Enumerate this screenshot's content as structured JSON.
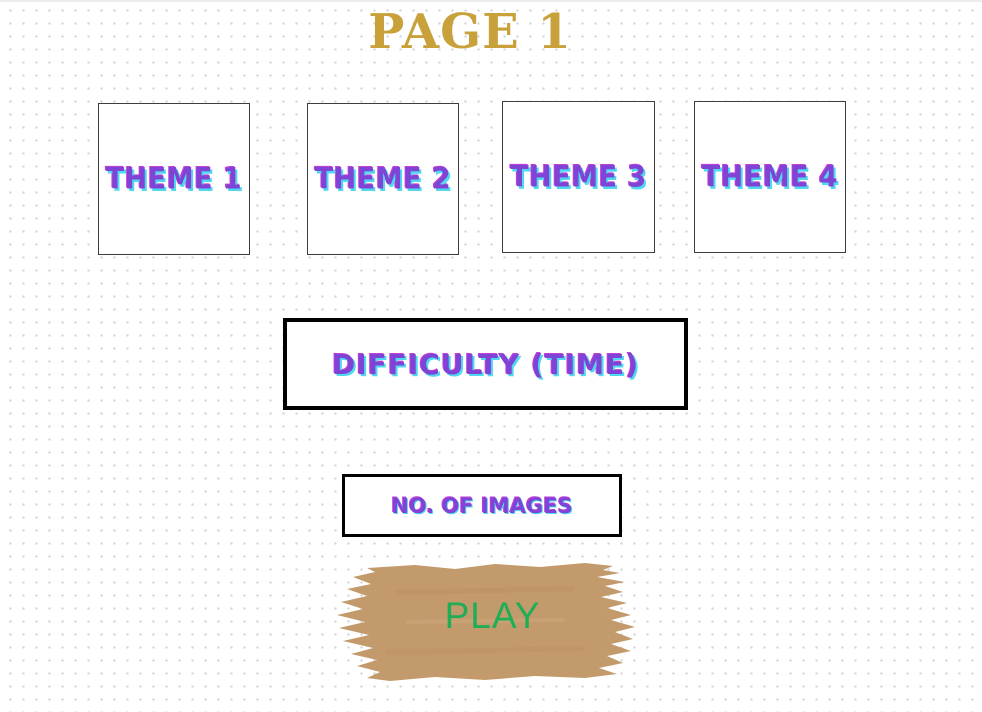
{
  "page": {
    "title": "PAGE 1"
  },
  "themes": [
    {
      "label": "THEME 1"
    },
    {
      "label": "THEME 2"
    },
    {
      "label": "THEME 3"
    },
    {
      "label": "THEME 4"
    }
  ],
  "difficulty": {
    "label": "DIFFICULTY (TIME)"
  },
  "images": {
    "label": "NO. OF IMAGES"
  },
  "play": {
    "label": "PLAY"
  },
  "colors": {
    "title": "#c9a13a",
    "theme_text": "#7f43d6",
    "theme_shadow": "#4fd9f0",
    "play_brush": "#c39a6b",
    "play_text": "#1fae56"
  }
}
